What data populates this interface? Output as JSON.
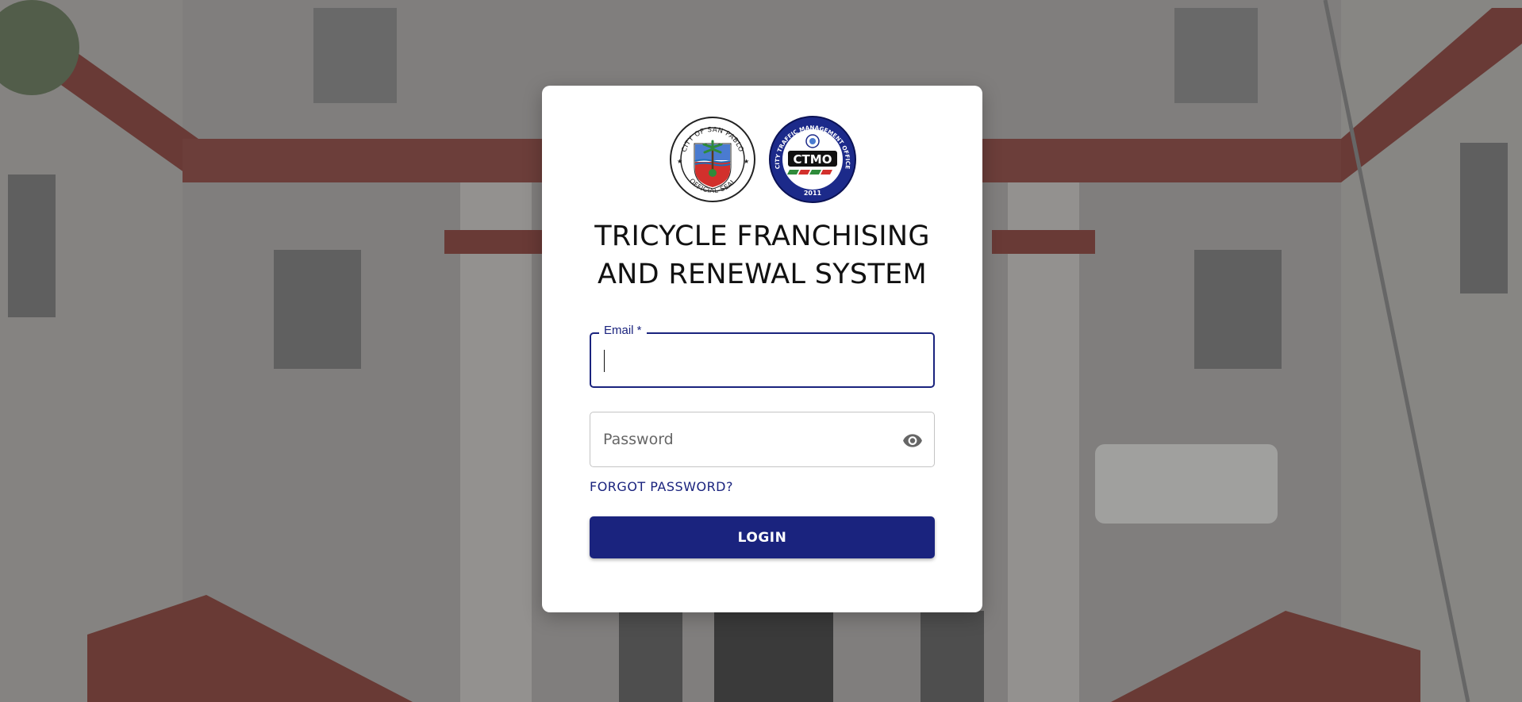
{
  "app": {
    "title_line1": "TRICYCLE FRANCHISING",
    "title_line2": "AND RENEWAL SYSTEM"
  },
  "logos": {
    "seal": {
      "icon": "city-seal-icon",
      "top_text": "CITY OF SAN PABLO",
      "bottom_text": "OFFICIAL SEAL"
    },
    "ctmo": {
      "icon": "ctmo-logo-icon",
      "center_text": "CTMO",
      "ring_text": "CITY TRAFFIC MANAGEMENT OFFICE",
      "year": "2011"
    }
  },
  "form": {
    "email": {
      "label": "Email *",
      "value": ""
    },
    "password": {
      "placeholder": "Password",
      "value": "",
      "toggle_icon": "eye-icon"
    },
    "forgot_label": "FORGOT PASSWORD?",
    "login_label": "LOGIN"
  },
  "colors": {
    "primary": "#1a237e",
    "card": "#ffffff",
    "building_trim": "#8b2a22"
  }
}
